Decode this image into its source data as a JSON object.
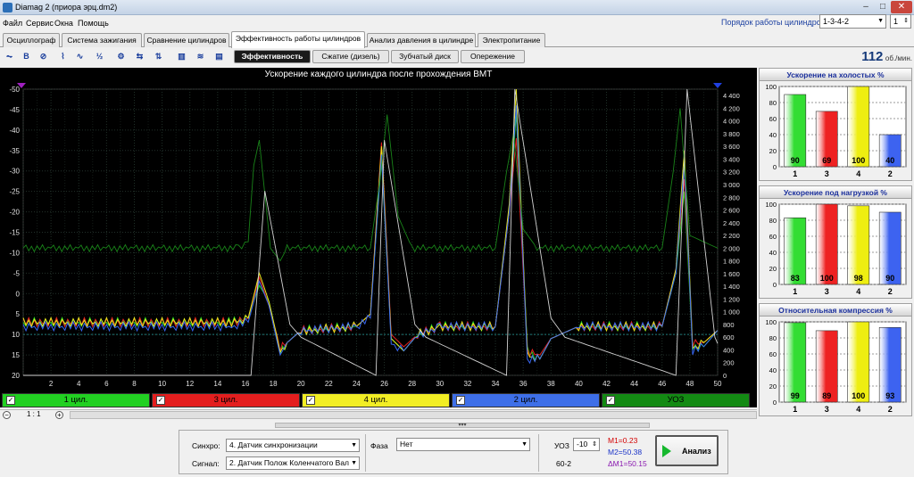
{
  "window": {
    "title": "Diamag 2 (приора эрц.dm2)",
    "min": "–",
    "max": "□",
    "close": "✕"
  },
  "menu": [
    "Файл",
    "Сервис",
    "Окна",
    "Помощь"
  ],
  "cylinder_order": {
    "label": "Порядок работы цилиндров",
    "value": "1-3-4-2",
    "count": "1"
  },
  "tabs": [
    {
      "label": "Осциллограф",
      "active": false
    },
    {
      "label": "Система зажигания",
      "active": false
    },
    {
      "label": "Сравнение цилиндров",
      "active": false
    },
    {
      "label": "Эффективность работы цилиндров",
      "active": true
    },
    {
      "label": "Анализ давления в цилиндре",
      "active": false
    },
    {
      "label": "Электропитание",
      "active": false
    }
  ],
  "toolbar_icons": [
    {
      "name": "signal-icon",
      "glyph": "⏦"
    },
    {
      "name": "bold-b-icon",
      "glyph": "B"
    },
    {
      "name": "reset-icon",
      "glyph": "⊘"
    },
    {
      "name": "curve-marker-icon",
      "glyph": "⌇"
    },
    {
      "name": "wave-icon",
      "glyph": "∿"
    },
    {
      "name": "fraction-icon",
      "glyph": "½"
    },
    {
      "name": "settings-icon",
      "glyph": "⚙"
    },
    {
      "name": "sync-icon",
      "glyph": "⇆"
    },
    {
      "name": "flip-icon",
      "glyph": "⇅"
    },
    {
      "name": "cylinders-icon",
      "glyph": "▥"
    },
    {
      "name": "waveform-icon",
      "glyph": "≋"
    },
    {
      "name": "bar-chart-icon",
      "glyph": "▤"
    }
  ],
  "subtabs": [
    {
      "label": "Эффективность",
      "active": true
    },
    {
      "label": "Сжатие (дизель)",
      "active": false
    },
    {
      "label": "Зубчатый диск",
      "active": false
    },
    {
      "label": "Опережение",
      "active": false
    }
  ],
  "rpm": {
    "value": "112",
    "unit": "об./мин."
  },
  "chart": {
    "title": "Ускорение каждого цилиндра после прохождения ВМТ",
    "colors": {
      "cyl1": "#22dd22",
      "cyl3": "#ee2222",
      "cyl4": "#f0f020",
      "cyl2": "#3a6cff",
      "uoz": "#1a8a1a",
      "white": "#dddddd",
      "grid": "#22302a"
    }
  },
  "chart_data": {
    "type": "line",
    "title": "Ускорение каждого цилиндра после прохождения ВМТ",
    "xlabel": "",
    "ylabel": "",
    "x_ticks": [
      "2",
      "4",
      "6",
      "8",
      "10",
      "12",
      "14",
      "16",
      "18",
      "20",
      "22",
      "24",
      "26",
      "28",
      "30",
      "32",
      "34",
      "36",
      "38",
      "40",
      "42",
      "44",
      "46",
      "48",
      "50"
    ],
    "y_left_ticks": [
      "-50",
      "-45",
      "-40",
      "-35",
      "-30",
      "-25",
      "-20",
      "-15",
      "-10",
      "-5",
      "0",
      "5",
      "10",
      "15",
      "20"
    ],
    "y_right_ticks": [
      "0",
      "200",
      "400",
      "600",
      "800",
      "1 000",
      "1 200",
      "1 400",
      "1 600",
      "1 800",
      "2 000",
      "2 200",
      "2 400",
      "2 600",
      "2 800",
      "3 000",
      "3 200",
      "3 400",
      "3 600",
      "3 800",
      "4 000",
      "4 200",
      "4 400"
    ],
    "xlim": [
      0,
      50
    ],
    "ylim_left": [
      -50,
      20
    ],
    "ylim_right": [
      0,
      4500
    ],
    "grid": true,
    "series": [
      {
        "name": "1 цил.",
        "color": "#22dd22",
        "x": [
          0,
          15,
          16.2,
          17,
          17.7,
          18.5,
          19,
          20,
          24,
          25,
          25.8,
          26.5,
          27.4,
          28.4,
          30,
          34,
          35,
          35.5,
          36.3,
          37.2,
          38,
          40,
          46,
          47,
          47.6,
          48.2,
          49,
          50
        ],
        "y": [
          7,
          7,
          6,
          -2,
          2,
          14,
          12,
          9,
          8,
          5,
          -33,
          11,
          14,
          10,
          8,
          8,
          -20,
          -44,
          14,
          16,
          11,
          8,
          8,
          -5,
          -25,
          13,
          13,
          9
        ]
      },
      {
        "name": "3 цил.",
        "color": "#ee2222",
        "x": [
          0,
          15,
          16.2,
          17,
          17.7,
          18.5,
          19,
          20,
          24,
          25,
          25.8,
          26.5,
          27.4,
          28.4,
          30,
          34,
          35,
          35.5,
          36.3,
          37.2,
          38,
          40,
          46,
          47,
          47.6,
          48.2,
          49,
          50
        ],
        "y": [
          7,
          7,
          6,
          -4,
          3,
          13,
          12,
          9,
          8,
          5,
          -37,
          10,
          13,
          10,
          8,
          8,
          -20,
          -38,
          14,
          15,
          11,
          8,
          8,
          -6,
          -28,
          12,
          12,
          9
        ]
      },
      {
        "name": "4 цил.",
        "color": "#f0f020",
        "x": [
          0,
          15,
          16.2,
          17,
          17.7,
          18.5,
          19,
          20,
          24,
          25,
          25.8,
          26.5,
          27.4,
          28.4,
          30,
          34,
          35,
          35.5,
          36.3,
          37.2,
          38,
          40,
          46,
          47,
          47.6,
          48.2,
          49,
          50
        ],
        "y": [
          7,
          7,
          6,
          -5,
          2,
          14,
          12,
          9,
          8,
          5,
          -36,
          11,
          14,
          10,
          8,
          8,
          -22,
          -50,
          15,
          16,
          11,
          8,
          8,
          -6,
          -35,
          13,
          12,
          9
        ]
      },
      {
        "name": "2 цил.",
        "color": "#3a6cff",
        "x": [
          0,
          15,
          16.2,
          17,
          17.7,
          18.5,
          19,
          20,
          24,
          25,
          25.8,
          26.5,
          27.4,
          28.4,
          30,
          34,
          35,
          35.5,
          36.3,
          37.2,
          38,
          40,
          46,
          47,
          47.6,
          48.2,
          49,
          50
        ],
        "y": [
          8,
          8,
          7,
          -3,
          3,
          15,
          12,
          9,
          8,
          6,
          -34,
          12,
          14,
          10,
          8,
          8,
          -20,
          -46,
          16,
          16,
          11,
          8,
          8,
          -5,
          -32,
          14,
          13,
          9
        ]
      },
      {
        "name": "УОЗ",
        "color": "#1a8a1a",
        "x": [
          0,
          15.5,
          16.2,
          16.6,
          17,
          17.8,
          18.5,
          19,
          20,
          25,
          25.7,
          26.2,
          27,
          28,
          34,
          34.8,
          35.3,
          36,
          37,
          46,
          46.8,
          47.3,
          48,
          50
        ],
        "y_right": [
          2000,
          2000,
          2100,
          3300,
          3700,
          2000,
          1800,
          2000,
          2000,
          2000,
          3100,
          4100,
          2500,
          2000,
          2000,
          3200,
          3800,
          2300,
          2000,
          2000,
          3200,
          4200,
          2200,
          2000
        ]
      },
      {
        "name": "",
        "color": "#dddddd",
        "x": [
          0,
          16.4,
          17.4,
          19.2,
          20,
          25.4,
          26,
          28.2,
          29,
          34.8,
          35.4,
          38,
          39,
          47,
          47.8,
          49.8,
          50
        ],
        "y_right": [
          0,
          0,
          2900,
          800,
          600,
          0,
          3700,
          800,
          600,
          0,
          4500,
          900,
          600,
          0,
          4500,
          600,
          500
        ]
      }
    ]
  },
  "channels": [
    {
      "label": "1 цил.",
      "color": "#22d022",
      "checked": true
    },
    {
      "label": "3 цил.",
      "color": "#e41e1e",
      "checked": true
    },
    {
      "label": "4 цил.",
      "color": "#f2ee24",
      "checked": true
    },
    {
      "label": "2 цил.",
      "color": "#3e6fe8",
      "checked": true
    },
    {
      "label": "УОЗ",
      "color": "#138a13",
      "checked": true
    }
  ],
  "zoom": {
    "minus": "−",
    "plus": "+",
    "value": "1 : 1"
  },
  "bottom": {
    "sync_label": "Синхро:",
    "sync_value": "4.  Датчик синхронизации",
    "signal_label": "Сигнал:",
    "signal_value": "2.  Датчик Полож Коленчатого Вал",
    "phase_label": "Фаза",
    "phase_value": "Нет",
    "uoz_label": "УОЗ",
    "uoz_value": "-10",
    "wheel": "60-2",
    "m1": "M1=0.23",
    "m2": "M2=50.38",
    "dm": "ΔM1=50.15",
    "analyze": "Анализ"
  },
  "bar_panels": [
    {
      "title": "Ускорение на холостых %",
      "categories": [
        "1",
        "3",
        "4",
        "2"
      ],
      "values": [
        90,
        69,
        100,
        40
      ],
      "ylim": [
        0,
        100
      ],
      "yticks": [
        "0",
        "20",
        "40",
        "60",
        "80",
        "100"
      ],
      "colors": [
        "#33dd33",
        "#ee2222",
        "#eeee11",
        "#3d63f0"
      ]
    },
    {
      "title": "Ускорение под нагрузкой %",
      "categories": [
        "1",
        "3",
        "4",
        "2"
      ],
      "values": [
        83,
        100,
        98,
        90
      ],
      "ylim": [
        0,
        100
      ],
      "yticks": [
        "0",
        "20",
        "40",
        "60",
        "80",
        "100"
      ],
      "colors": [
        "#33dd33",
        "#ee2222",
        "#eeee11",
        "#3d63f0"
      ]
    },
    {
      "title": "Относительная компрессия %",
      "categories": [
        "1",
        "3",
        "4",
        "2"
      ],
      "values": [
        99,
        89,
        100,
        93
      ],
      "ylim": [
        0,
        100
      ],
      "yticks": [
        "0",
        "20",
        "40",
        "60",
        "80",
        "100"
      ],
      "colors": [
        "#33dd33",
        "#ee2222",
        "#eeee11",
        "#3d63f0"
      ]
    }
  ]
}
